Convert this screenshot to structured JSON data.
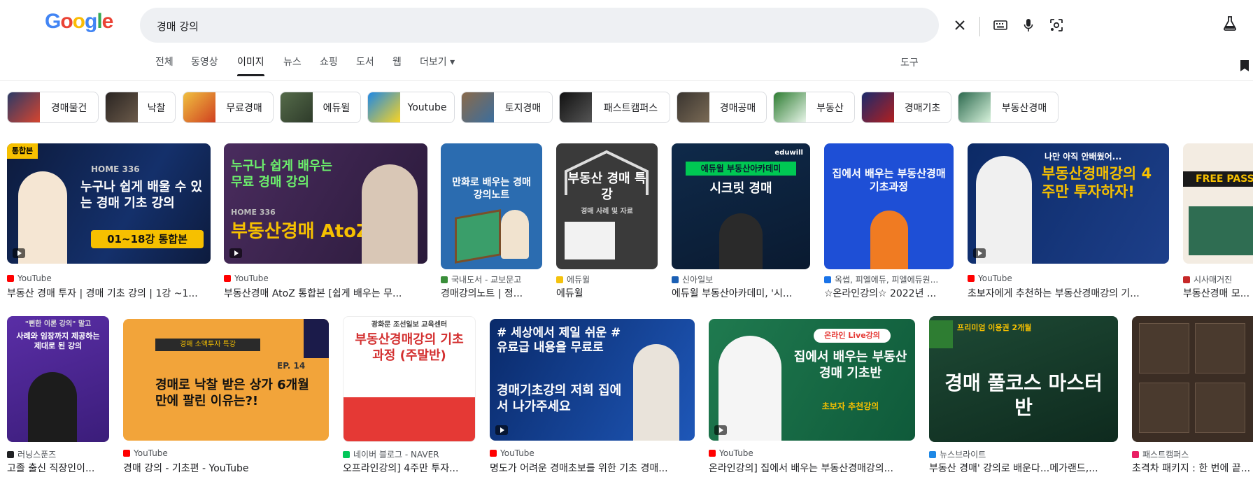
{
  "logo": [
    "G",
    "o",
    "o",
    "g",
    "l",
    "e"
  ],
  "search": {
    "value": "경매 강의"
  },
  "tabs": [
    "전체",
    "동영상",
    "이미지",
    "뉴스",
    "쇼핑",
    "도서",
    "웹",
    "더보기 ▾"
  ],
  "tools_label": "도구",
  "chips": [
    "경매물건",
    "낙찰",
    "무료경매",
    "에듀윌",
    "Youtube",
    "토지경매",
    "패스트캠퍼스",
    "경매공매",
    "부동산",
    "경매기초",
    "부동산경매"
  ],
  "row1": [
    {
      "source": "YouTube",
      "title": "부동산 경매 투자 | 경매 기초 강의 | 1강 ~1...",
      "image_text": "누구나 쉽게 배울 수 있는 경매 기초 강의",
      "image_sub": "01~18강 통합본",
      "image_tag": "HOME 336"
    },
    {
      "source": "YouTube",
      "title": "부동산경매 AtoZ 통합본 [쉽게 배우는 무...",
      "image_text": "누구나 쉽게 배우는 무료 경매 강의",
      "image_sub": "부동산경매 AtoZ",
      "image_tag": "HOME 336"
    },
    {
      "source": "국내도서 - 교보문고",
      "title": "경매강의노트 | 정...",
      "image_text": "만화로 배우는 경매강의노트",
      "image_sub": "",
      "image_tag": ""
    },
    {
      "source": "에듀윌",
      "title": "에듀윌",
      "image_text": "부동산 경매 특강",
      "image_sub": "경매 사례 및 자료",
      "image_tag": ""
    },
    {
      "source": "신아일보",
      "title": "에듀윌 부동산아카데미, '시...",
      "image_text": "시크릿 경매",
      "image_sub": "에듀윌 부동산아카데미",
      "image_tag": "eduwill"
    },
    {
      "source": "옥썹, 피엘에듀, 피엘에듀원...",
      "title": "☆온라인강의☆ 2022년 ...",
      "image_text": "집에서 배우는 부동산경매 기초과정",
      "image_sub": "",
      "image_tag": ""
    },
    {
      "source": "YouTube",
      "title": "초보자에게 추천하는 부동산경매강의 기...",
      "image_text": "부동산경매강의 4주만 투자하자!",
      "image_sub": "나만 아직 안배웠어...",
      "image_tag": ""
    },
    {
      "source": "시사매거진",
      "title": "부동산경매 모...",
      "image_text": "FREE PASS",
      "image_sub": "",
      "image_tag": ""
    }
  ],
  "row2": [
    {
      "source": "러닝스푼즈",
      "title": "고졸 출신 직장인이...",
      "image_text": "사례와 임장까지 제공하는 제대로 된 강의",
      "image_sub": "\"뻔한 이론 강의\" 말고",
      "image_tag": ""
    },
    {
      "source": "YouTube",
      "title": "경매 강의 - 기초편 - YouTube",
      "image_text": "경매로 낙찰 받은 상가 6개월만에 팔린 이유는?!",
      "image_sub": "경매 소액투자 특강",
      "image_tag": "EP. 14"
    },
    {
      "source": "네이버 블로그 - NAVER",
      "title": "오프라인강의] 4주만 투자...",
      "image_text": "부동산경매강의 기초과정 (주말반)",
      "image_sub": "광화문 조선일보 교육센터",
      "image_tag": ""
    },
    {
      "source": "YouTube",
      "title": "명도가 어려운 경매초보를 위한 기초 경매...",
      "image_text": "# 세상에서 제일 쉬운 # 유료급 내용을 무료로",
      "image_sub": "경매기초강의 저희 집에서 나가주세요",
      "image_tag": ""
    },
    {
      "source": "YouTube",
      "title": "온라인강의] 집에서 배우는 부동산경매강의...",
      "image_text": "집에서 배우는 부동산경매 기초반",
      "image_sub": "초보자 추천강의",
      "image_tag": "온라인 Live강의"
    },
    {
      "source": "뉴스브라이트",
      "title": "부동산 경매' 강의로 배운다...메가랜드,...",
      "image_text": "경매 풀코스 마스터반",
      "image_sub": "프리미엄 이용권 2개월",
      "image_tag": ""
    },
    {
      "source": "패스트캠퍼스",
      "title": "초격차 패키지 : 한 번에 끝...",
      "image_text": "",
      "image_sub": "",
      "image_tag": ""
    }
  ],
  "colors": {
    "source_icons": [
      "#ff0000",
      "#ff0000",
      "#3a8e3a",
      "#f4c20d",
      "#1a5fb4",
      "#1a73e8",
      "#ff0000",
      "#c62828"
    ]
  }
}
